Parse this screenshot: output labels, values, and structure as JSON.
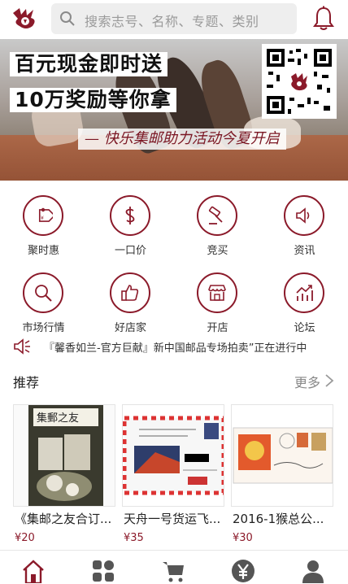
{
  "header": {
    "search_placeholder": "搜索志号、名称、专题、类别",
    "brand_color": "#8b1a2a"
  },
  "banner": {
    "headline_line1": "百元现金即时送",
    "headline_line2": "10万奖励等你拿",
    "slogan": "— 快乐集邮助力活动今夏开启",
    "slide_count": 4,
    "active_slide": 1
  },
  "categories": [
    {
      "label": "聚时惠",
      "icon": "price-tag-icon"
    },
    {
      "label": "一口价",
      "icon": "dollar-icon"
    },
    {
      "label": "竞买",
      "icon": "auction-hammer-icon"
    },
    {
      "label": "资讯",
      "icon": "speaker-icon"
    },
    {
      "label": "市场行情",
      "icon": "magnifier-icon"
    },
    {
      "label": "好店家",
      "icon": "thumbs-up-icon"
    },
    {
      "label": "开店",
      "icon": "shop-icon"
    },
    {
      "label": "论坛",
      "icon": "trend-chart-icon"
    }
  ],
  "notice": {
    "text": "『馨香如兰-官方巨献』新中国邮品专场拍卖”正在进行中"
  },
  "recommend": {
    "title": "推荐",
    "more": "更多",
    "items": [
      {
        "title": "《集邮之友合订...",
        "price": "¥20"
      },
      {
        "title": "天舟一号货运飞...",
        "price": "¥35"
      },
      {
        "title": "2016-1猴总公...",
        "price": "¥30"
      }
    ]
  },
  "tabbar": {
    "items": [
      "home-icon",
      "category-icon",
      "cart-icon",
      "yuan-icon",
      "user-icon"
    ],
    "active": 0
  }
}
